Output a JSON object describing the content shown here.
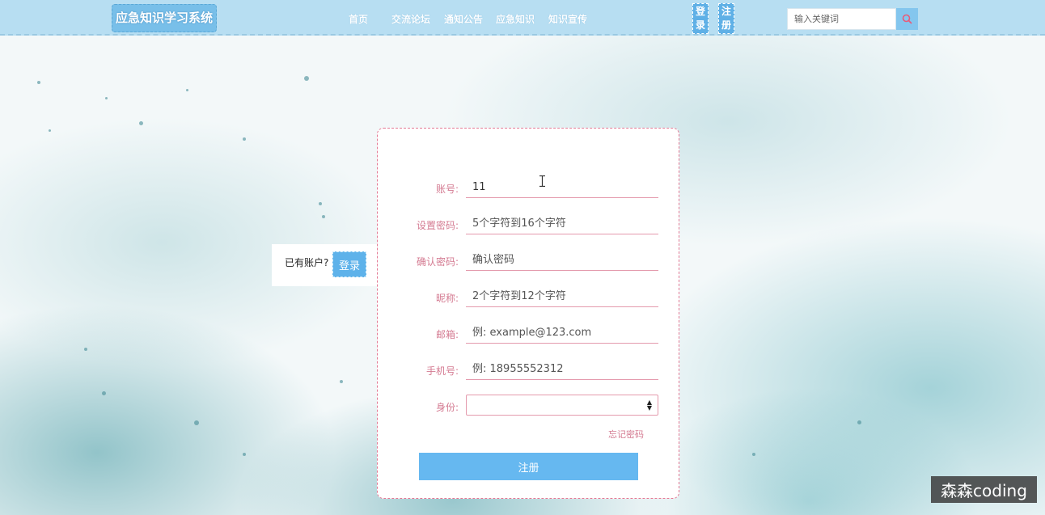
{
  "header": {
    "logo": "应急知识学习系统",
    "nav": [
      "首页",
      "交流论坛",
      "通知公告",
      "应急知识",
      "知识宣传"
    ],
    "login_label": "登录",
    "register_label": "注册",
    "search": {
      "placeholder": "输入关键词",
      "value": ""
    }
  },
  "login_hint": {
    "text": "已有账户?",
    "button": "登录"
  },
  "form": {
    "fields": [
      {
        "label": "账号:",
        "value": "11",
        "placeholder": ""
      },
      {
        "label": "设置密码:",
        "value": "",
        "placeholder": "5个字符到16个字符"
      },
      {
        "label": "确认密码:",
        "value": "",
        "placeholder": "确认密码"
      },
      {
        "label": "昵称:",
        "value": "",
        "placeholder": "2个字符到12个字符"
      },
      {
        "label": "邮箱:",
        "value": "",
        "placeholder": "例: example@123.com"
      },
      {
        "label": "手机号:",
        "value": "",
        "placeholder": "例: 18955552312"
      }
    ],
    "identity": {
      "label": "身份:",
      "selected": ""
    },
    "forgot_label": "忘记密码",
    "submit_label": "注册"
  },
  "watermark": "森森coding",
  "colors": {
    "header_bg": "#b7def2",
    "accent_blue": "#66b8f0",
    "label_pink": "#d47a91",
    "card_border": "#e47a95"
  },
  "icons": {
    "search": "search-icon",
    "select_arrows": "select-arrows-icon"
  }
}
